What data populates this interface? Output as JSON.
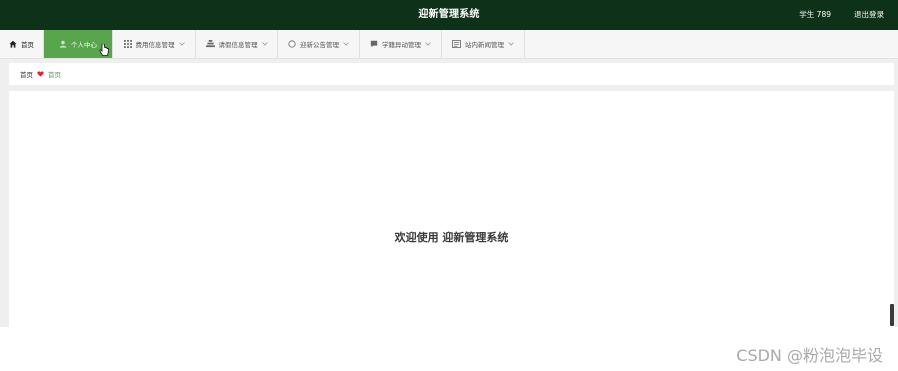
{
  "header": {
    "title": "迎新管理系统",
    "user": "学生 789",
    "logout_label": "退出登录"
  },
  "nav": {
    "items": [
      {
        "label": "首页",
        "icon": "home-icon"
      },
      {
        "label": "个人中心",
        "icon": "user-icon",
        "active": true
      },
      {
        "label": "费用信息管理",
        "icon": "grid-icon",
        "dropdown": true
      },
      {
        "label": "请假信息管理",
        "icon": "stack-icon",
        "dropdown": true
      },
      {
        "label": "迎新公告管理",
        "icon": "circle-icon",
        "dropdown": true
      },
      {
        "label": "学籍异动管理",
        "icon": "chat-icon",
        "dropdown": true
      },
      {
        "label": "站内新闻管理",
        "icon": "news-icon",
        "dropdown": true
      }
    ]
  },
  "breadcrumb": {
    "root": "首页",
    "current": "首页",
    "separator_icon": "heart-icon"
  },
  "main": {
    "welcome": "欢迎使用 迎新管理系统"
  },
  "watermark": "CSDN @粉泡泡毕设",
  "colors": {
    "header_bg": "#0e3219",
    "nav_active_bg": "#59a54e",
    "accent_green": "#59a54e",
    "heart_red": "#e02424"
  }
}
